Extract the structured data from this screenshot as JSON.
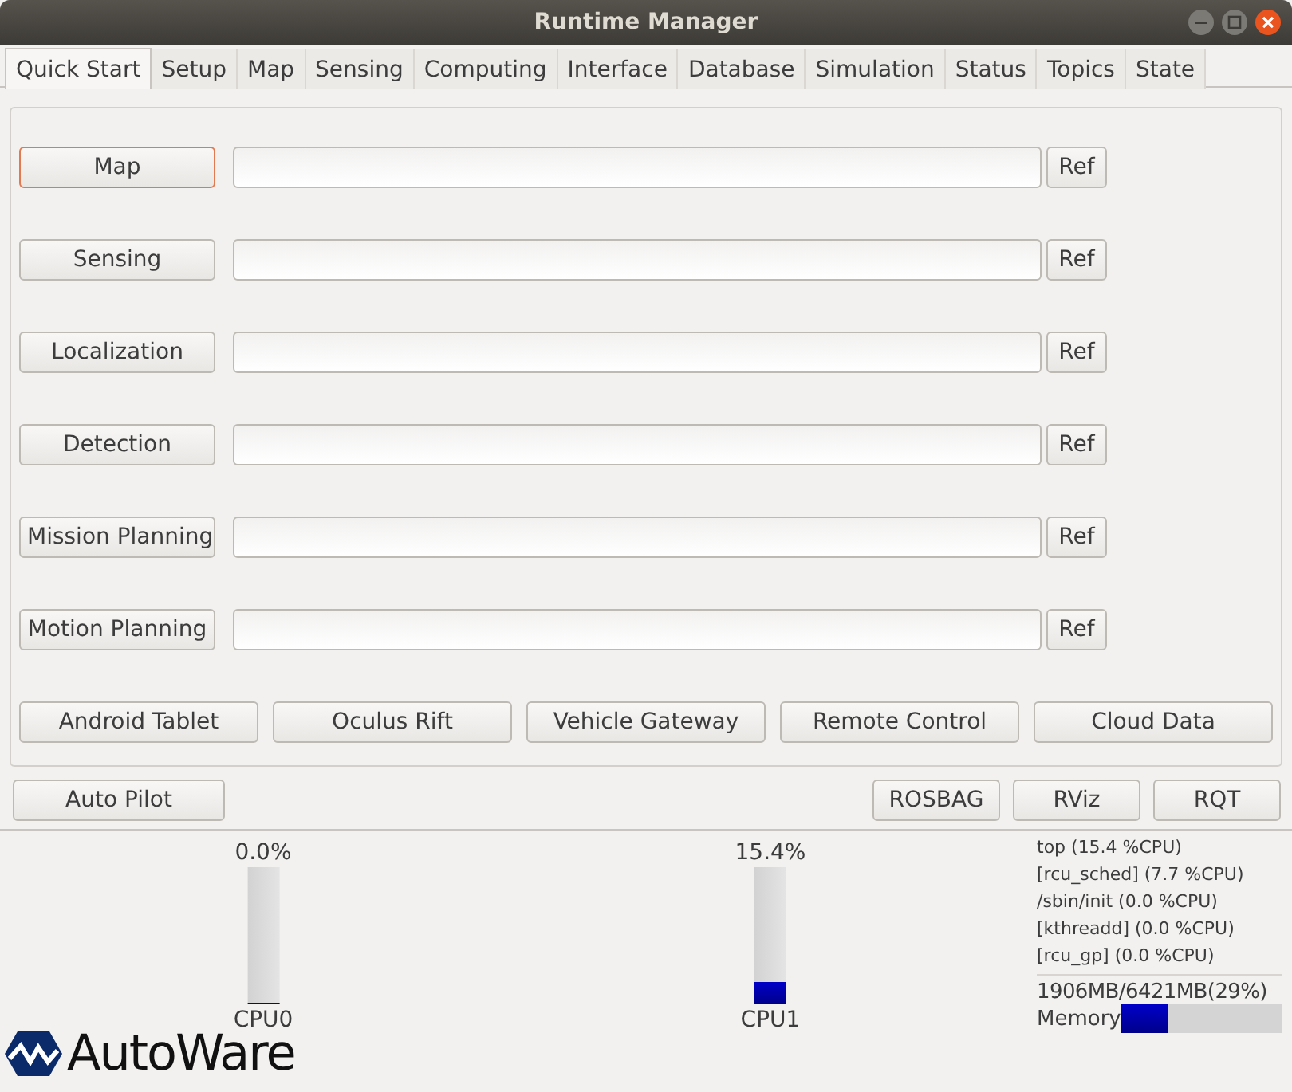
{
  "window": {
    "title": "Runtime Manager"
  },
  "tabs": [
    {
      "label": "Quick Start",
      "selected": true
    },
    {
      "label": "Setup",
      "selected": false
    },
    {
      "label": "Map",
      "selected": false
    },
    {
      "label": "Sensing",
      "selected": false
    },
    {
      "label": "Computing",
      "selected": false
    },
    {
      "label": "Interface",
      "selected": false
    },
    {
      "label": "Database",
      "selected": false
    },
    {
      "label": "Simulation",
      "selected": false
    },
    {
      "label": "Status",
      "selected": false
    },
    {
      "label": "Topics",
      "selected": false
    },
    {
      "label": "State",
      "selected": false
    }
  ],
  "launch_rows": [
    {
      "label": "Map",
      "focused": true,
      "ref": "Ref"
    },
    {
      "label": "Sensing",
      "focused": false,
      "ref": "Ref"
    },
    {
      "label": "Localization",
      "focused": false,
      "ref": "Ref"
    },
    {
      "label": "Detection",
      "focused": false,
      "ref": "Ref"
    },
    {
      "label": "Mission Planning",
      "focused": false,
      "ref": "Ref"
    },
    {
      "label": "Motion Planning",
      "focused": false,
      "ref": "Ref"
    }
  ],
  "device_buttons": [
    "Android Tablet",
    "Oculus Rift",
    "Vehicle Gateway",
    "Remote Control",
    "Cloud Data"
  ],
  "left_buttons": [
    "Auto Pilot"
  ],
  "right_buttons": [
    "ROSBAG",
    "RViz",
    "RQT"
  ],
  "cpus": [
    {
      "reading": "0.0%",
      "level": 0,
      "name": "CPU0"
    },
    {
      "reading": "15.4%",
      "level": 0.154,
      "name": "CPU1"
    }
  ],
  "processes": [
    "top (15.4 %CPU)",
    "[rcu_sched] (7.7 %CPU)",
    "/sbin/init (0.0 %CPU)",
    "[kthreadd] (0.0 %CPU)",
    "[rcu_gp] (0.0 %CPU)"
  ],
  "memory": {
    "reading": "1906MB/6421MB(29%)",
    "label": "Memory",
    "level": 0.29
  },
  "logo": {
    "text": "AutoWare"
  }
}
